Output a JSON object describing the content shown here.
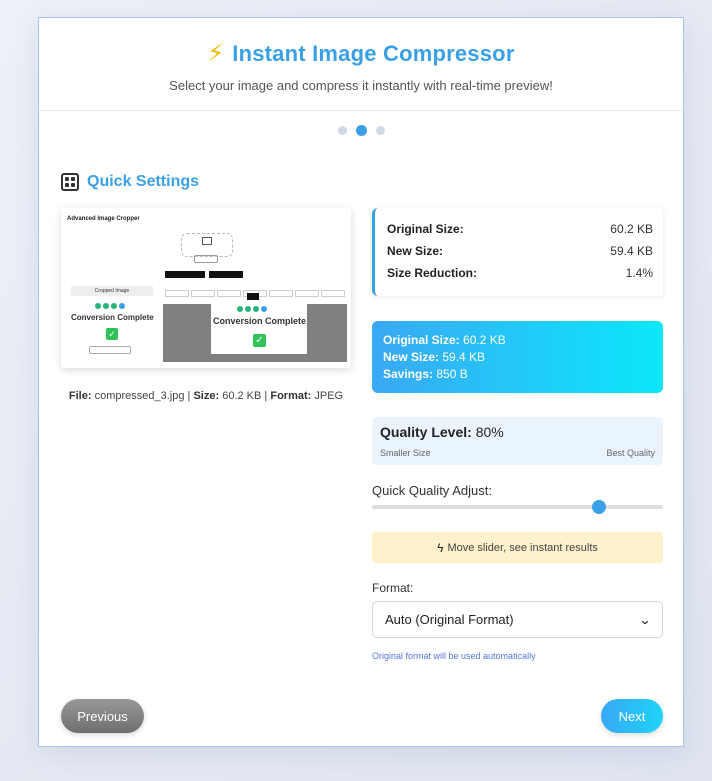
{
  "header": {
    "icon": "lightning-icon",
    "title": "Instant Image Compressor",
    "subtitle": "Select your image and compress it instantly with real-time preview!"
  },
  "steps": {
    "count": 3,
    "active_index": 1
  },
  "section": {
    "icon": "grid-icon",
    "title": "Quick Settings"
  },
  "preview": {
    "thumb_title": "Advanced Image Cropper",
    "thumb_panel_label": "Cropped Image",
    "thumb_conversion_text": "Conversion Complete"
  },
  "file_info": {
    "file_label": "File:",
    "file_value": "compressed_3.jpg",
    "size_label": "Size:",
    "size_value": "60.2 KB",
    "format_label": "Format:",
    "format_value": "JPEG",
    "sep": "|"
  },
  "stats": {
    "original_label": "Original Size:",
    "original_value": "60.2 KB",
    "new_label": "New Size:",
    "new_value": "59.4 KB",
    "reduction_label": "Size Reduction:",
    "reduction_value": "1.4%"
  },
  "summary": {
    "original_label": "Original Size:",
    "original_value": "60.2 KB",
    "new_label": "New Size:",
    "new_value": "59.4 KB",
    "savings_label": "Savings:",
    "savings_value": "850 B"
  },
  "quality": {
    "label": "Quality Level:",
    "value": "80%",
    "min_label": "Smaller Size",
    "max_label": "Best Quality"
  },
  "slider": {
    "label": "Quick Quality Adjust:",
    "value_fraction": 0.78
  },
  "hint": {
    "icon": "lightning-icon",
    "text": "Move slider, see instant results"
  },
  "format": {
    "label": "Format:",
    "selected": "Auto (Original Format)",
    "note": "Original format will be used automatically"
  },
  "nav": {
    "prev_label": "Previous",
    "next_label": "Next"
  },
  "colors": {
    "accent": "#3aa0e6",
    "gradient_end": "#0be8fb",
    "hint_bg": "#fdf2cc"
  }
}
